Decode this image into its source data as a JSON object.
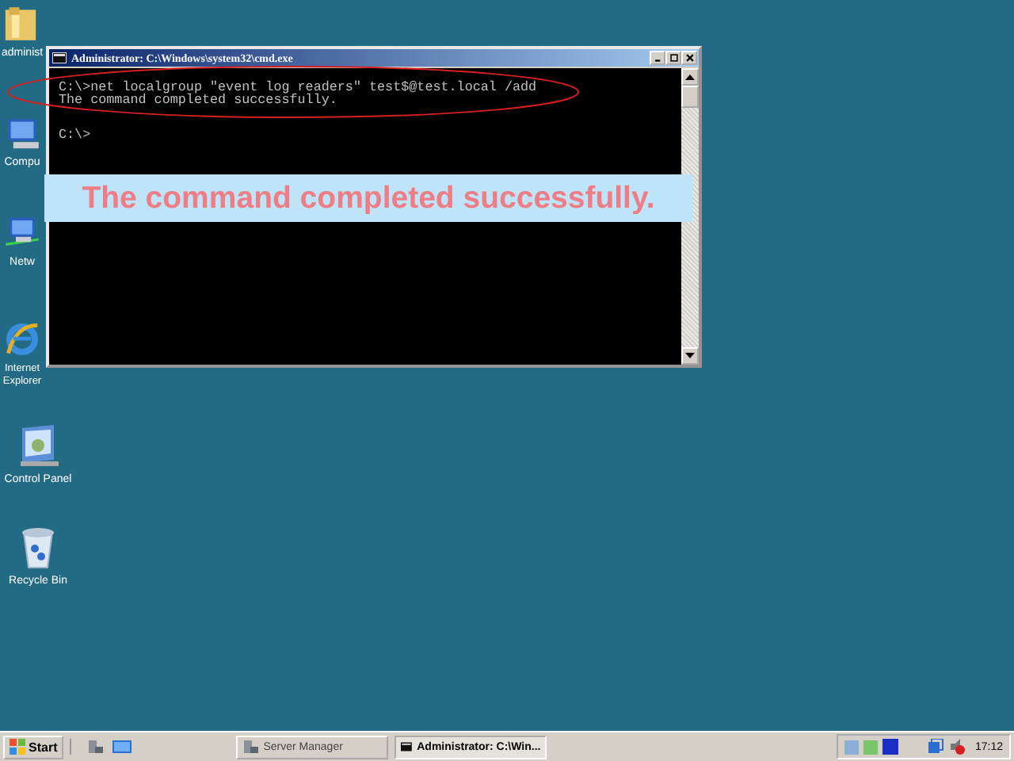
{
  "desktop_icons": [
    {
      "kind": "folder",
      "label": "administ"
    },
    {
      "kind": "computer",
      "label": "Compu"
    },
    {
      "kind": "network",
      "label": "Netw"
    },
    {
      "kind": "browser",
      "label": "Internet Explorer"
    },
    {
      "kind": "control",
      "label": "Control Panel"
    },
    {
      "kind": "recycle",
      "label": "Recycle Bin"
    }
  ],
  "window": {
    "title": "Administrator: C:\\Windows\\system32\\cmd.exe",
    "lines": [
      {
        "text": "C:\\>net localgroup \"event log readers\" test$@test.local /add",
        "gap_before": false
      },
      {
        "text": "The command completed successfully.",
        "gap_before": false
      },
      {
        "text": "C:\\>",
        "gap_before": true
      }
    ]
  },
  "callout": "The command completed successfully.",
  "taskbar": {
    "start": "Start",
    "tasks": [
      {
        "label": "Server Manager",
        "kind": "server",
        "selected": false
      },
      {
        "label": "Administrator: C:\\Win...",
        "kind": "console",
        "selected": true
      }
    ],
    "clock": "17:12"
  }
}
